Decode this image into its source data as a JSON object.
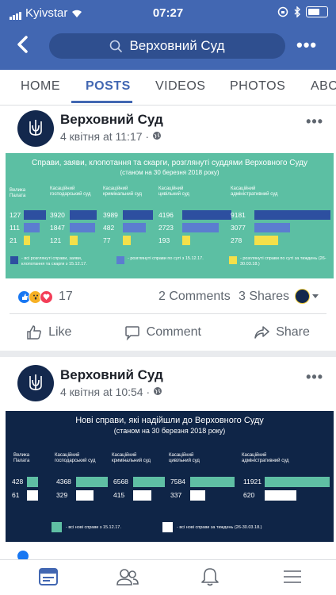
{
  "status_bar": {
    "carrier": "Kyivstar",
    "time": "07:27"
  },
  "nav_bar": {
    "search_text": "Верховний Суд"
  },
  "tabs": [
    {
      "label": "HOME"
    },
    {
      "label": "POSTS"
    },
    {
      "label": "VIDEOS"
    },
    {
      "label": "PHOTOS"
    },
    {
      "label": "ABO"
    }
  ],
  "posts": [
    {
      "author": "Верховний Суд",
      "meta": "4 квітня at 11:17 · ",
      "infographic": {
        "title": "Справи, заяви, клопотання та скарги, розглянуті суддями Верховного Суду",
        "subtitle": "(станом на 30 березня 2018 року)",
        "columns": [
          {
            "label": "Велика Палата",
            "values": [
              127,
              111,
              21
            ]
          },
          {
            "label": "Касаційний господарський суд",
            "values": [
              3920,
              1847,
              121
            ]
          },
          {
            "label": "Касаційний кримінальний суд",
            "values": [
              3989,
              482,
              77
            ]
          },
          {
            "label": "Касаційний цивільний суд",
            "values": [
              4196,
              2723,
              193
            ]
          },
          {
            "label": "Касаційний адміністративний суд",
            "values": [
              9181,
              3077,
              278
            ]
          }
        ],
        "legend": [
          {
            "text": "- всі розглянуті справи, заяви, клопотання та скарги з 15.12.17.",
            "color": "#2d4fa0"
          },
          {
            "text": "- розглянуті справи по суті з 15.12.17.",
            "color": "#5b7dd0"
          },
          {
            "text": "- розглянуті справи по суті за тиждень (26-30.03.18.)",
            "color": "#f4e04a"
          }
        ]
      },
      "reactions_count": "17",
      "comments": "2 Comments",
      "shares": "3 Shares"
    },
    {
      "author": "Верховний Суд",
      "meta": "4 квітня at 10:54 · ",
      "infographic": {
        "title": "Нові справи, які надійшли до Верховного Суду",
        "subtitle": "(станом на 30 березня 2018 року)",
        "columns": [
          {
            "label": "Велика Палата",
            "values": [
              428,
              61
            ]
          },
          {
            "label": "Касаційний господарський суд",
            "values": [
              4368,
              329
            ]
          },
          {
            "label": "Касаційний кримінальний суд",
            "values": [
              6568,
              415
            ]
          },
          {
            "label": "Касаційний цивільний суд",
            "values": [
              7584,
              337
            ]
          },
          {
            "label": "Касаційний адміністративний суд",
            "values": [
              11921,
              620
            ]
          }
        ],
        "legend": [
          {
            "text": "- всі нові справи з 15.12.17.",
            "color": "#5fbfa4"
          },
          {
            "text": "- всі нові справи за тиждень (26-30.03.18.)",
            "color": "#ffffff"
          }
        ]
      }
    }
  ],
  "actions": {
    "like": "Like",
    "comment": "Comment",
    "share": "Share"
  }
}
